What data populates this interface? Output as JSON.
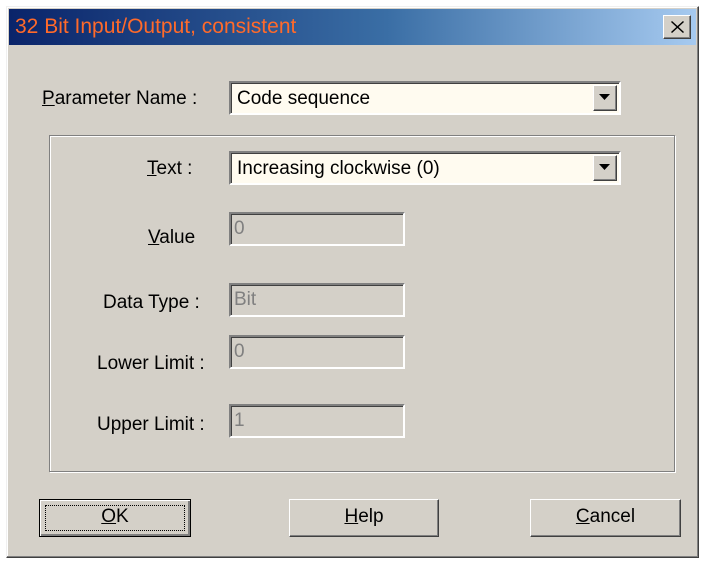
{
  "window": {
    "title": "32 Bit Input/Output, consistent"
  },
  "parameter_name": {
    "label_accel": "P",
    "label_rest": "arameter Name :",
    "value": "Code sequence"
  },
  "text_field": {
    "label_accel": "T",
    "label_rest": "ext :",
    "value": "Increasing clockwise (0)"
  },
  "value_field": {
    "label_accel": "V",
    "label_rest": "alue",
    "value": "0"
  },
  "data_type": {
    "label": "Data Type :",
    "value": "Bit"
  },
  "lower_limit": {
    "label": "Lower Limit :",
    "value": "0"
  },
  "upper_limit": {
    "label": "Upper Limit :",
    "value": "1"
  },
  "buttons": {
    "ok_accel": "O",
    "ok_rest": "K",
    "help_accel": "H",
    "help_rest": "elp",
    "cancel_accel": "C",
    "cancel_rest": "ancel"
  },
  "colors": {
    "title_text": "#ff6a2a",
    "dialog_bg": "#d4d0c8",
    "combo_bg": "#fffbf0",
    "disabled_text": "#808080"
  }
}
